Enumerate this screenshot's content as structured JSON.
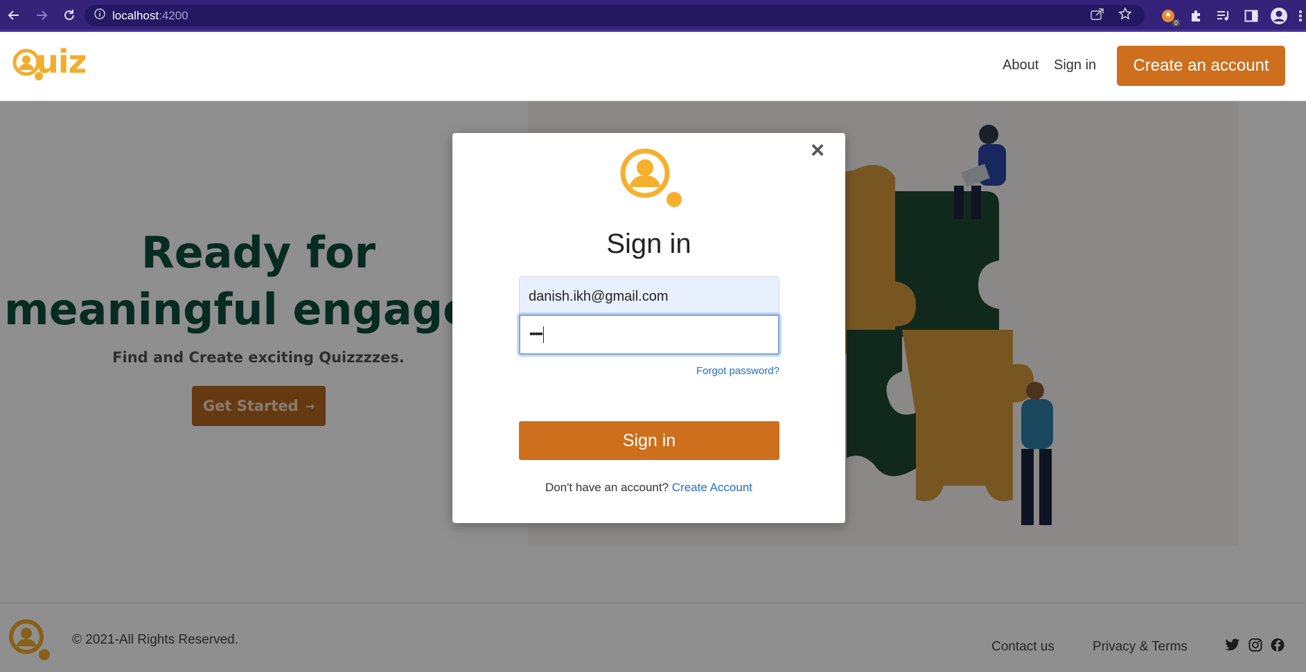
{
  "browser": {
    "url_host": "localhost",
    "url_port": ":4200",
    "extension_badge": "0"
  },
  "header": {
    "logo_text": "uiz",
    "nav_about": "About",
    "nav_signin": "Sign in",
    "create_account": "Create an account"
  },
  "hero": {
    "title_line1": "Ready for",
    "title_line2": "meaningful engageme",
    "subtitle": "Find and Create exciting Quizzzzes.",
    "cta": "Get Started",
    "cta_arrow": "→"
  },
  "footer": {
    "copyright": "© 2021-All Rights Reserved.",
    "contact": "Contact us",
    "privacy": "Privacy & Terms",
    "social": [
      "twitter-icon",
      "instagram-icon",
      "facebook-icon"
    ]
  },
  "modal": {
    "close": "×",
    "title": "Sign in",
    "email_value": "danish.ikh@gmail.com",
    "password_mask": "•••••",
    "forgot": "Forgot password?",
    "submit": "Sign in",
    "no_account": "Don't have an account?",
    "create_link": "Create Account"
  },
  "colors": {
    "brand_orange": "#cd6f1d",
    "logo_yellow": "#f2ad2c",
    "hero_green": "#0d4d3a",
    "chrome_purple": "#35237a"
  }
}
